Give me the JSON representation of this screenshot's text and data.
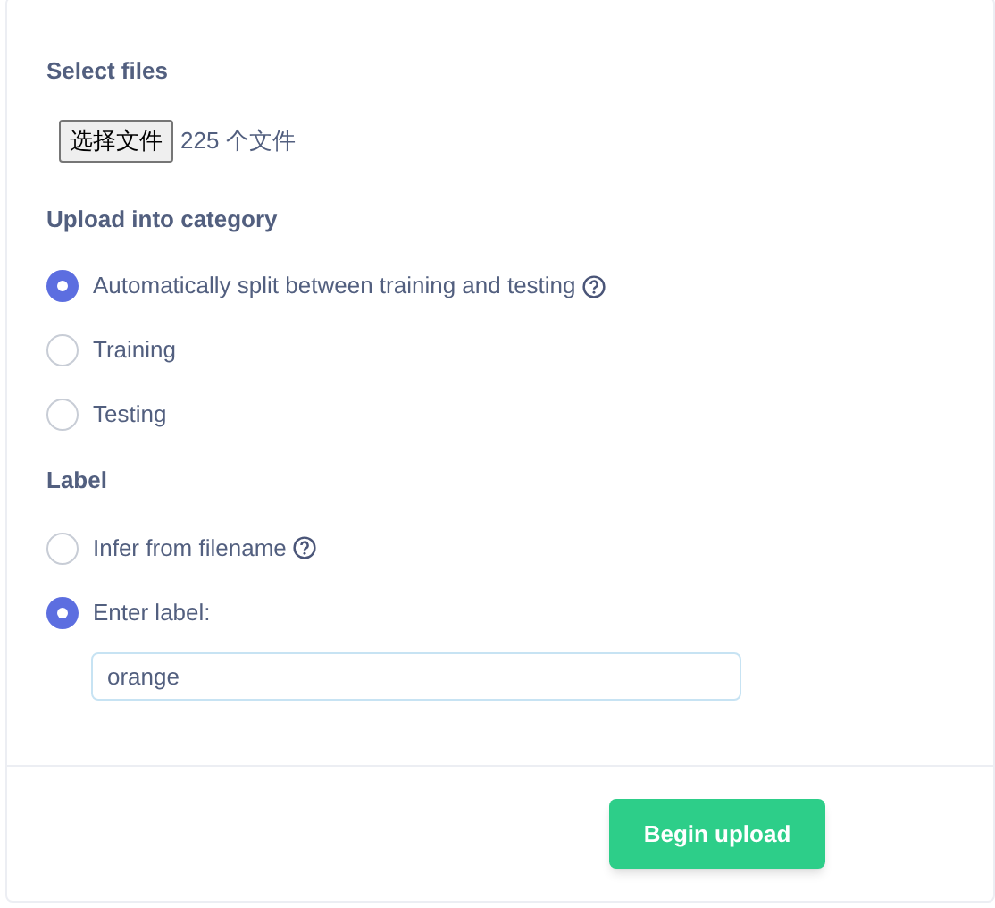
{
  "select_files": {
    "heading": "Select files",
    "button": "选择文件",
    "status": "225 个文件"
  },
  "category": {
    "heading": "Upload into category",
    "options": [
      {
        "label": "Automatically split between training and testing",
        "selected": true,
        "help": true
      },
      {
        "label": "Training",
        "selected": false,
        "help": false
      },
      {
        "label": "Testing",
        "selected": false,
        "help": false
      }
    ]
  },
  "label": {
    "heading": "Label",
    "options": [
      {
        "label": "Infer from filename",
        "selected": false,
        "help": true
      },
      {
        "label": "Enter label:",
        "selected": true,
        "help": false
      }
    ],
    "value": "orange"
  },
  "submit": "Begin upload"
}
